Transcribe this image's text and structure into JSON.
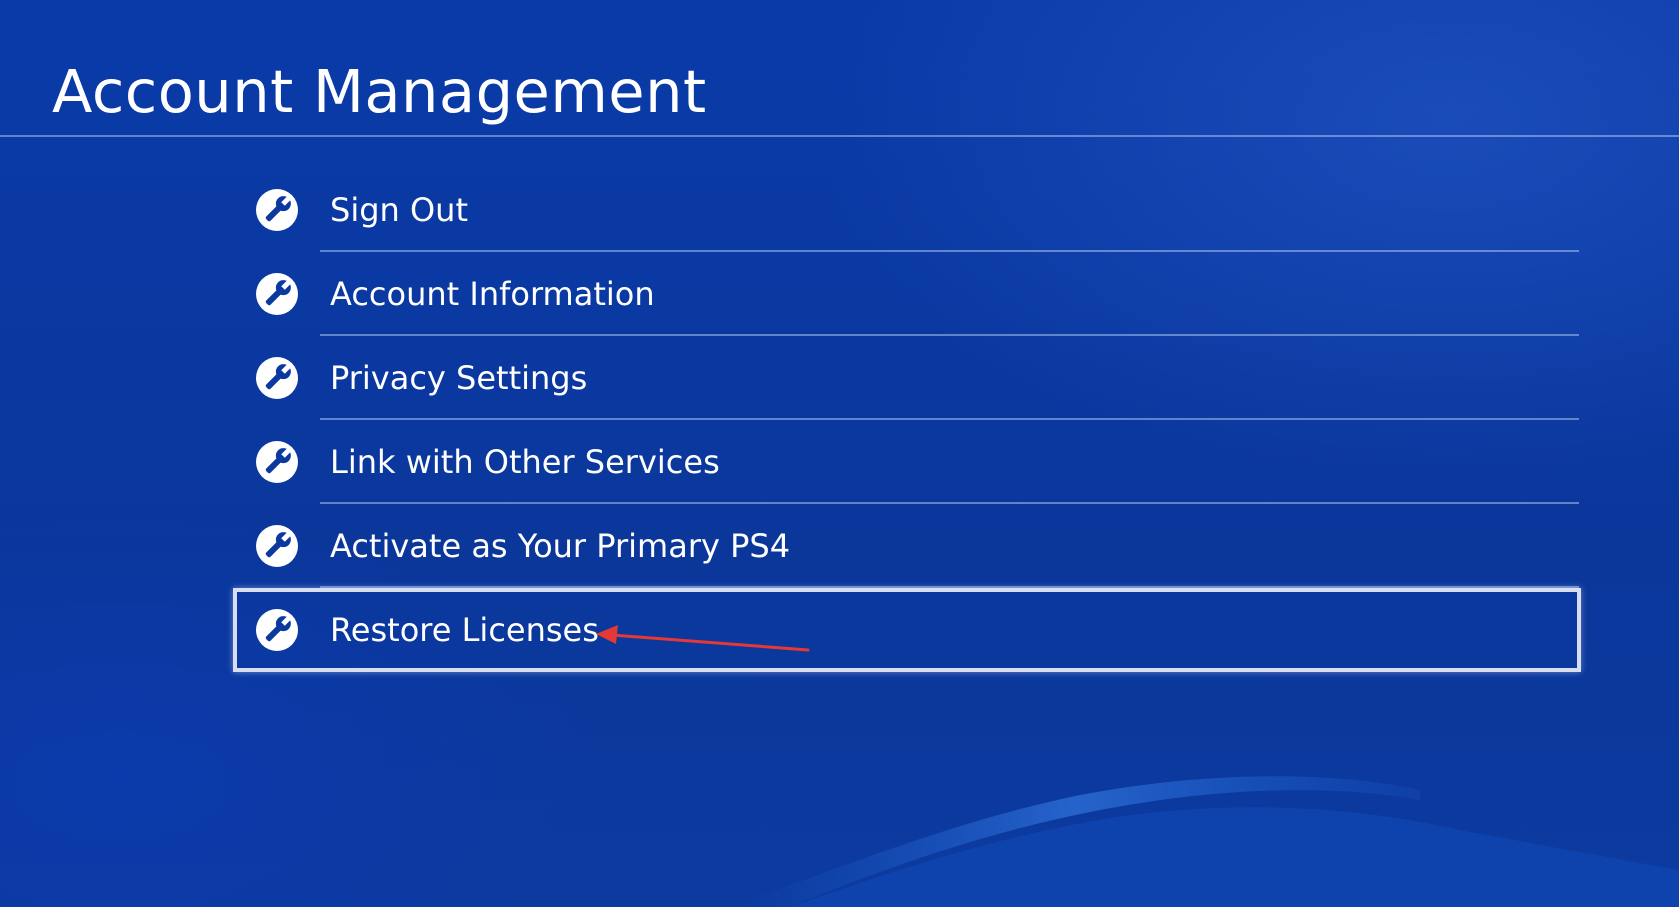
{
  "page": {
    "title": "Account Management"
  },
  "menu": {
    "items": [
      {
        "label": "Sign Out",
        "icon": "wrench-icon",
        "selected": false
      },
      {
        "label": "Account Information",
        "icon": "wrench-icon",
        "selected": false
      },
      {
        "label": "Privacy Settings",
        "icon": "wrench-icon",
        "selected": false
      },
      {
        "label": "Link with Other Services",
        "icon": "wrench-icon",
        "selected": false
      },
      {
        "label": "Activate as Your Primary PS4",
        "icon": "wrench-icon",
        "selected": false
      },
      {
        "label": "Restore Licenses",
        "icon": "wrench-icon",
        "selected": true
      }
    ]
  },
  "annotation": {
    "type": "arrow",
    "points_to": "Restore Licenses",
    "color": "#e53935"
  },
  "colors": {
    "background": "#0b39a0",
    "text": "#ffffff",
    "focus_border": "#d6def0",
    "separator": "#8ea8dc"
  }
}
